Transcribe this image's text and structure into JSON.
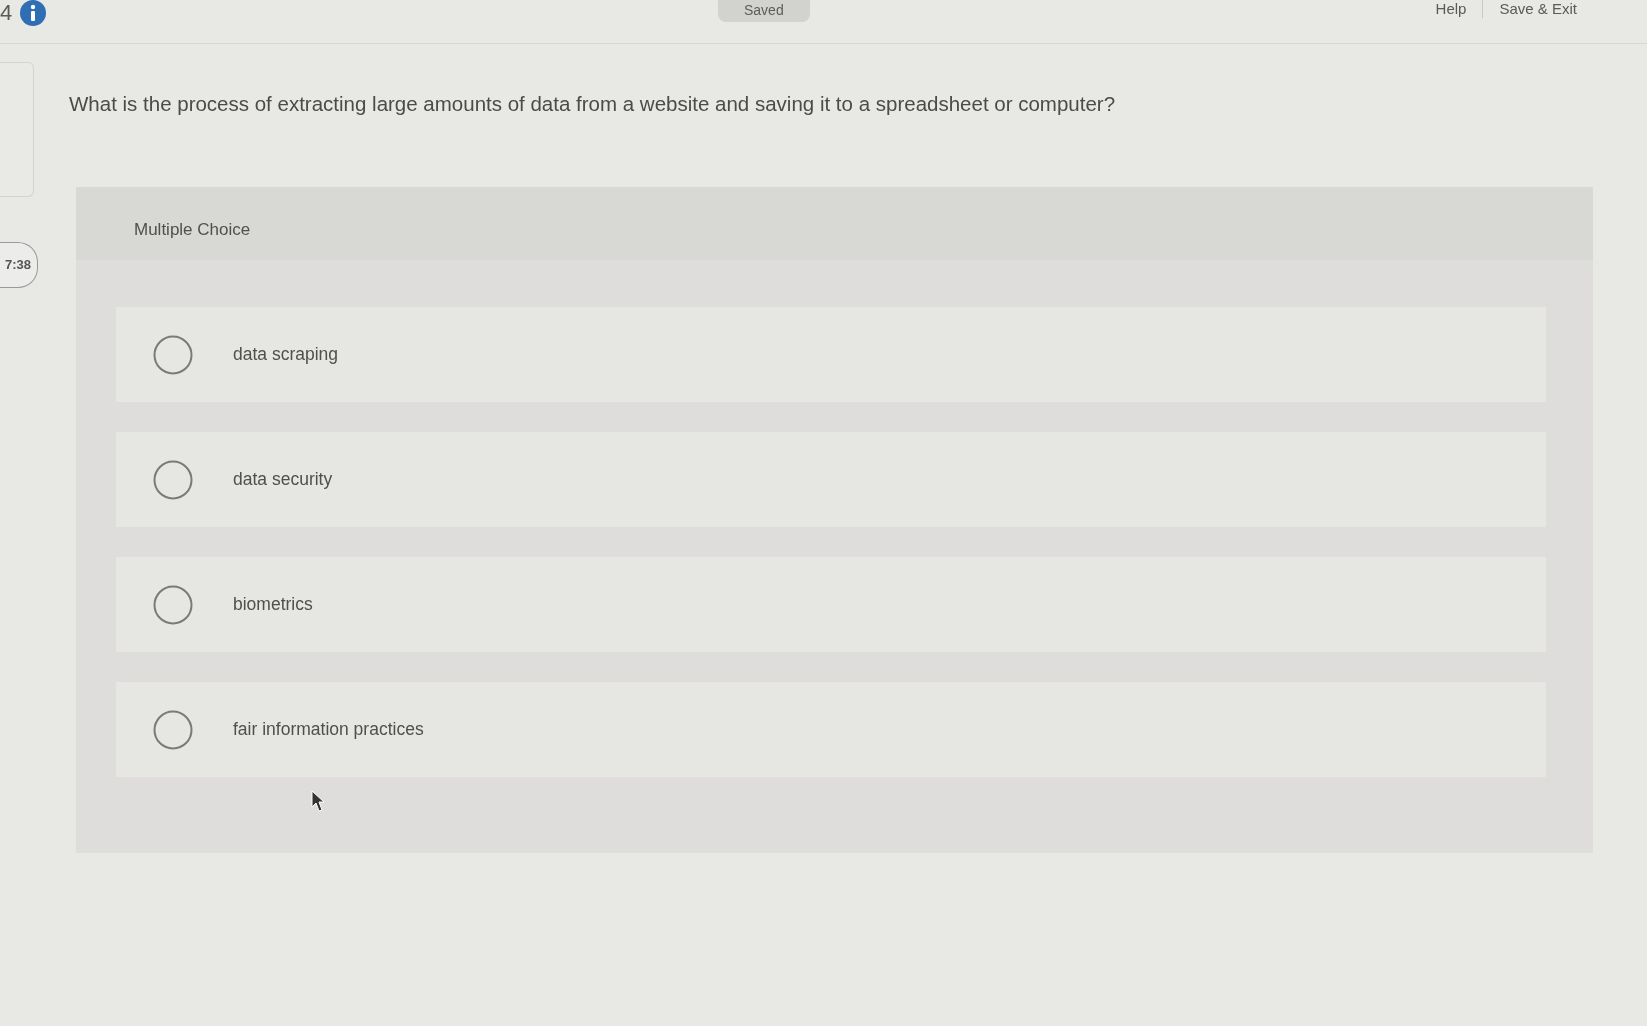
{
  "header": {
    "question_number": "4",
    "status": "Saved",
    "links": [
      "Help",
      "Save & Exit"
    ]
  },
  "timer": "7:38",
  "question": {
    "prompt": "What is the process of extracting large amounts of data from a website and saving it to a spreadsheet or computer?",
    "type_label": "Multiple Choice",
    "options": [
      {
        "label": "data scraping",
        "selected": false
      },
      {
        "label": "data security",
        "selected": false
      },
      {
        "label": "biometrics",
        "selected": false
      },
      {
        "label": "fair information practices",
        "selected": false
      }
    ]
  }
}
